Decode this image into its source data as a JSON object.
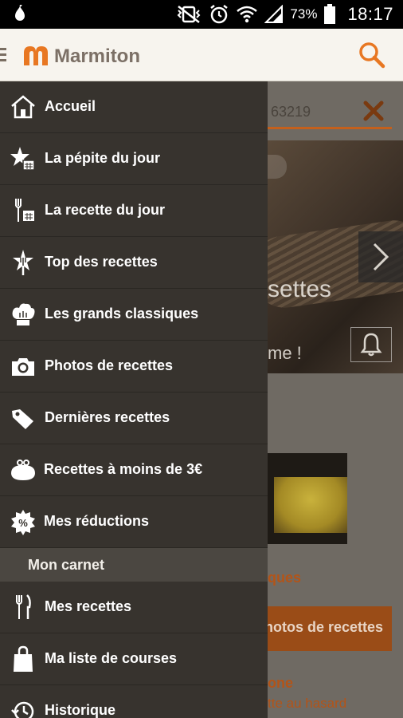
{
  "status": {
    "battery": "73%",
    "time": "18:17"
  },
  "appbar": {
    "brand": "Marmiton",
    "brand_color": "#7c7066",
    "accent": "#e87722"
  },
  "background": {
    "search_value": "63219",
    "hero_text1": "settes",
    "hero_text2": "me !",
    "section_link": "ques",
    "photos_button": "hotos de recettes",
    "link2": "one",
    "link3": "tte au hasard"
  },
  "drawer": {
    "items": [
      {
        "label": "Accueil",
        "icon": "house-icon"
      },
      {
        "label": "La pépite du jour",
        "icon": "star-calendar-icon"
      },
      {
        "label": "La recette du jour",
        "icon": "fork-calendar-icon"
      },
      {
        "label": "Top des recettes",
        "icon": "top-star-icon"
      },
      {
        "label": "Les grands classiques",
        "icon": "chef-hat-icon"
      },
      {
        "label": "Photos de recettes",
        "icon": "camera-icon"
      },
      {
        "label": "Dernières recettes",
        "icon": "tag-icon"
      },
      {
        "label": "Recettes à moins de 3€",
        "icon": "purse-icon"
      },
      {
        "label": "Mes réductions",
        "icon": "percent-badge-icon"
      }
    ],
    "section_title": "Mon carnet",
    "carnet_items": [
      {
        "label": "Mes recettes",
        "icon": "cutlery-icon"
      },
      {
        "label": "Ma liste de courses",
        "icon": "shopping-bag-icon"
      },
      {
        "label": "Historique",
        "icon": "history-icon"
      }
    ]
  }
}
